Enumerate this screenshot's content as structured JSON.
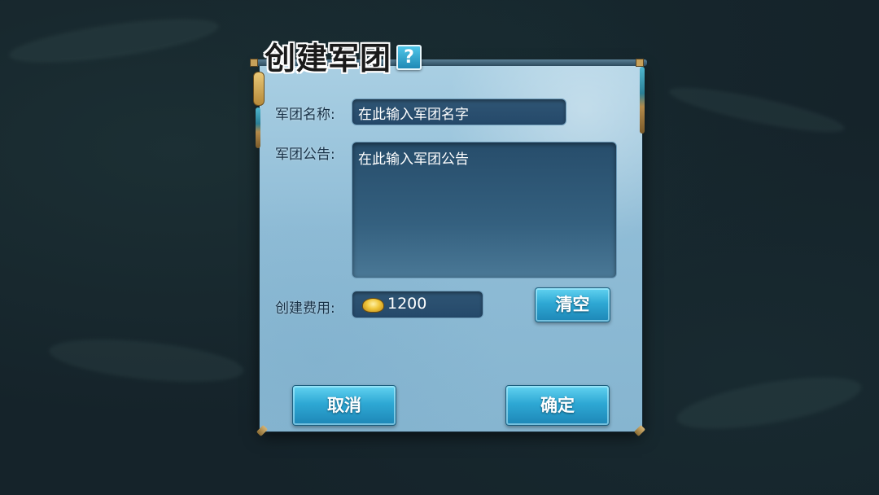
{
  "dialog": {
    "title": "创建军团",
    "help_label": "?"
  },
  "form": {
    "name_label": "军团名称:",
    "name_placeholder": "在此输入军团名字",
    "notice_label": "军团公告:",
    "notice_placeholder": "在此输入军团公告",
    "cost_label": "创建费用:",
    "cost_value": "1200",
    "cost_icon": "gold-ingot-icon"
  },
  "buttons": {
    "clear_label": "清空",
    "cancel_label": "取消",
    "confirm_label": "确定"
  },
  "colors": {
    "panel": "#8fbcd6",
    "field": "#2f5574",
    "button": "#2ea8d4"
  }
}
